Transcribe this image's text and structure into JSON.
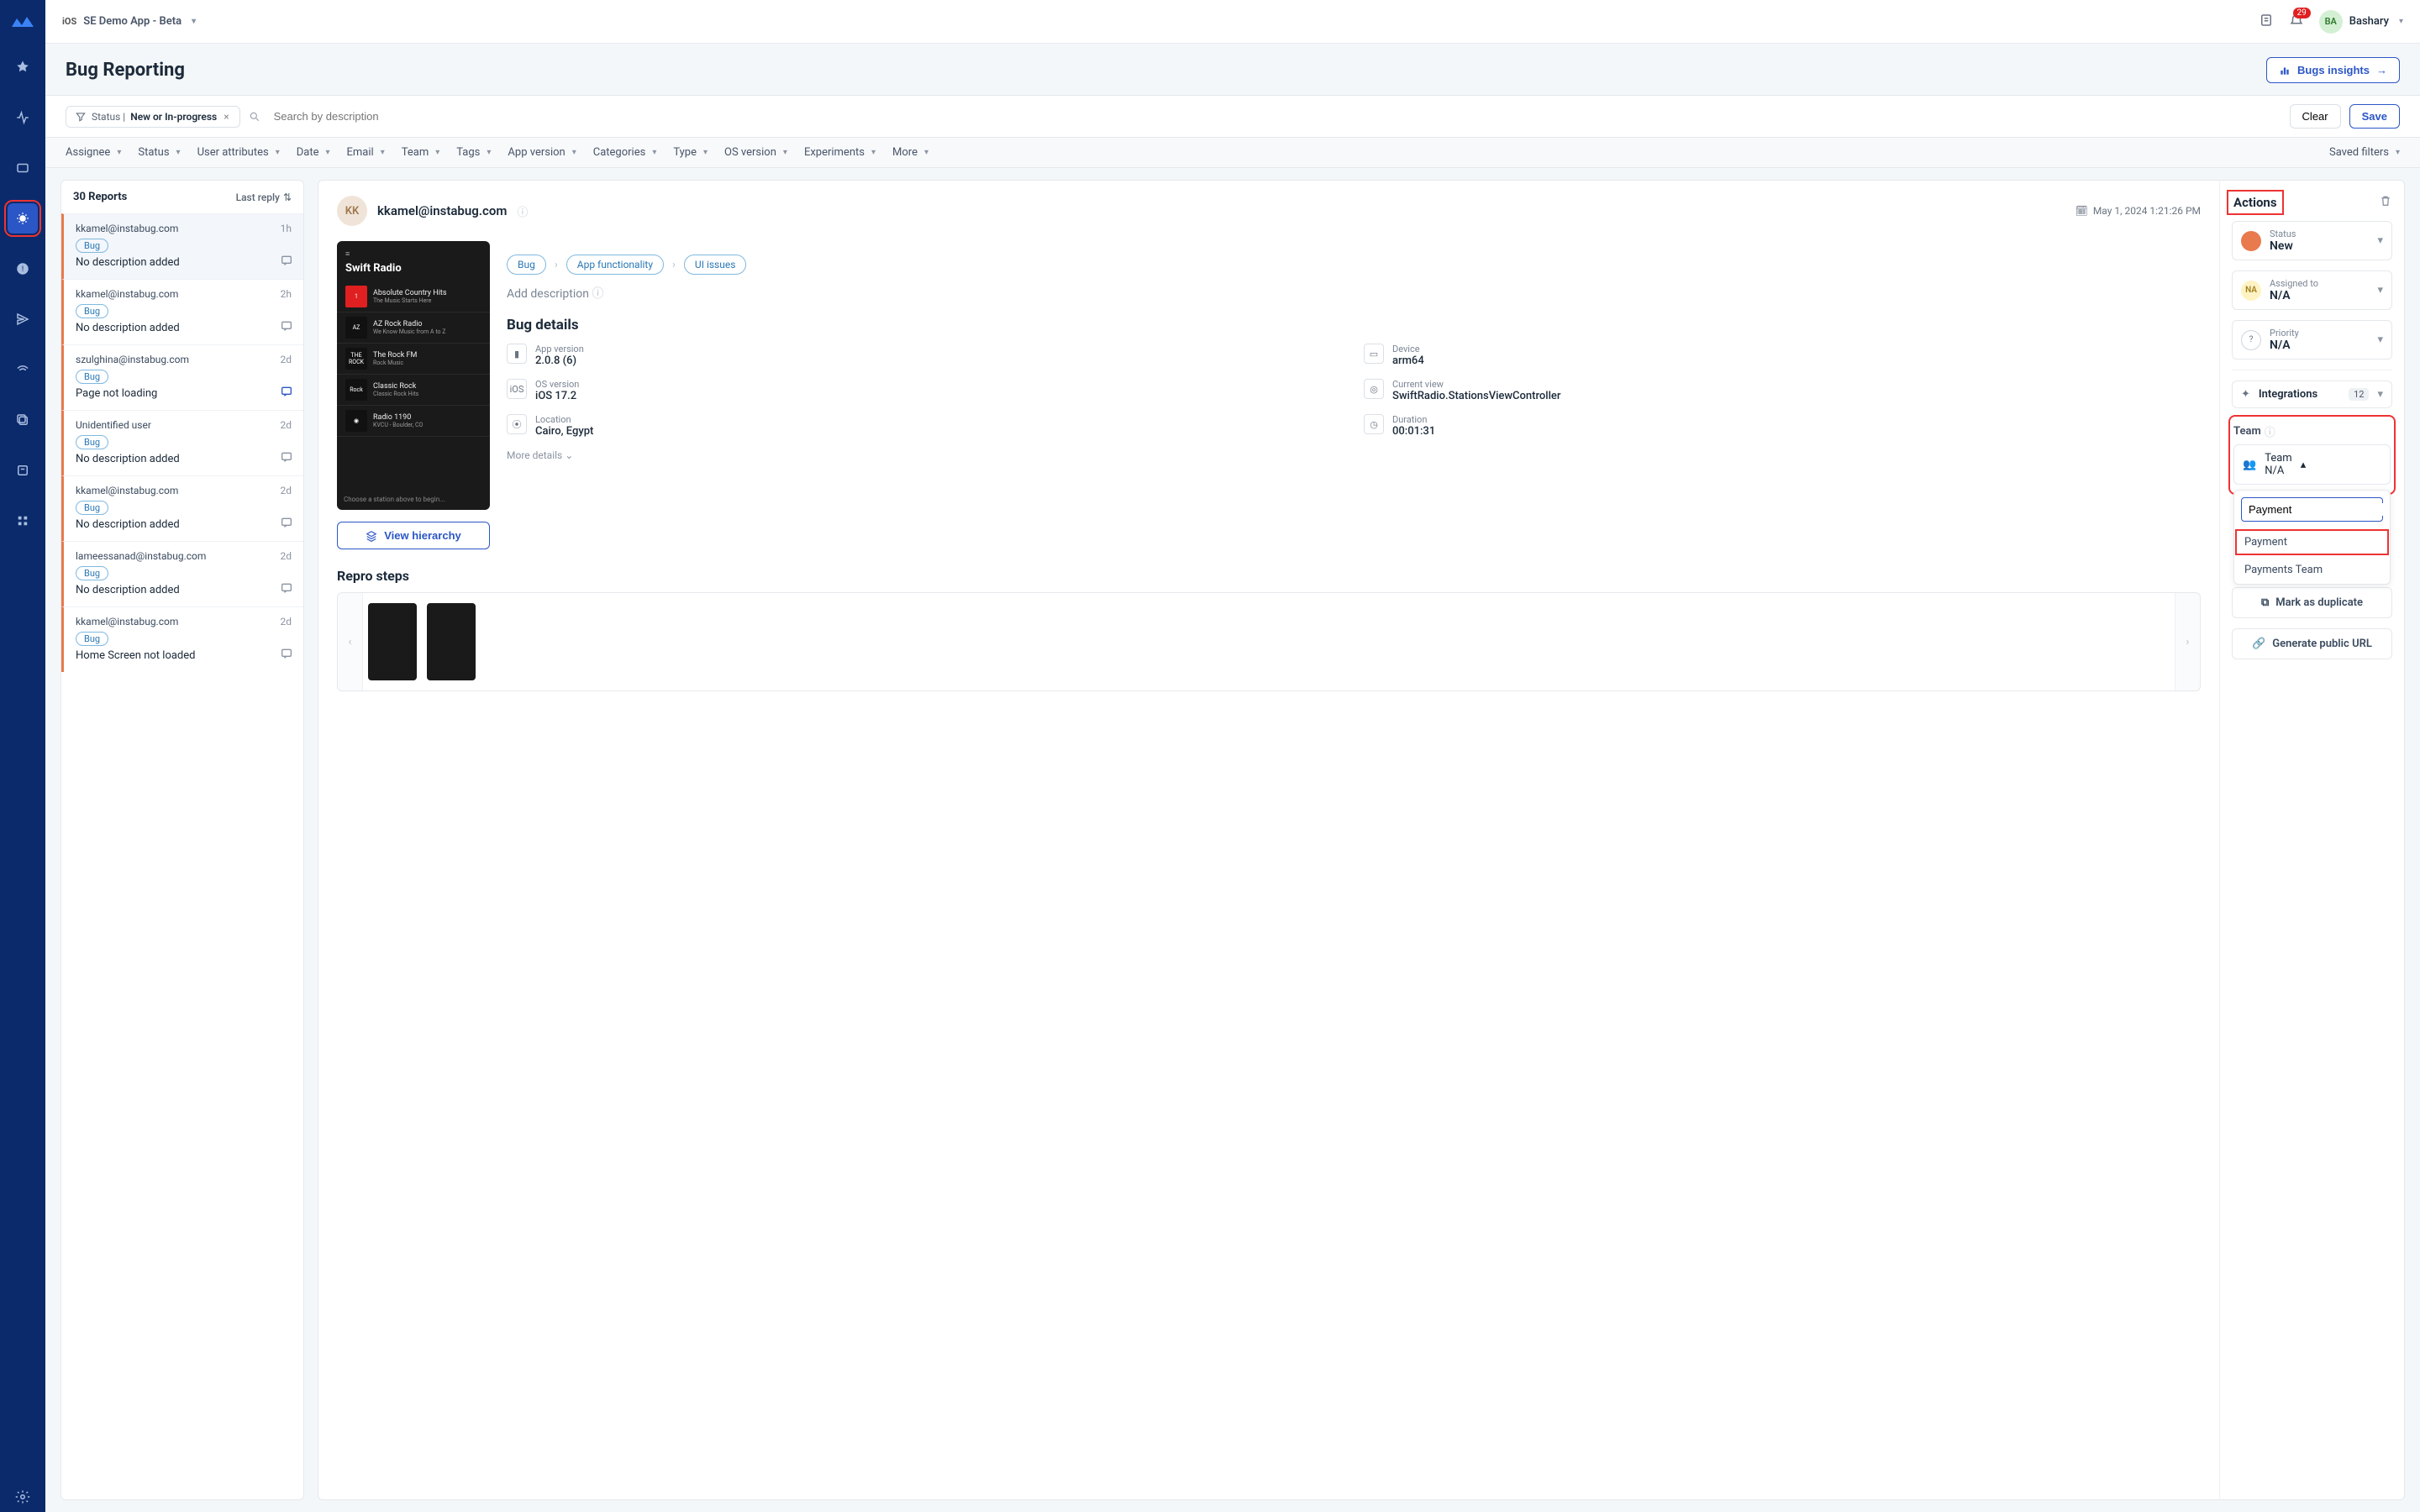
{
  "header": {
    "platform_badge": "iOS",
    "app_name": "SE Demo App - Beta",
    "notif_count": "29",
    "user_initials": "BA",
    "user_name": "Bashary"
  },
  "page": {
    "title": "Bug Reporting",
    "insights_button": "Bugs insights"
  },
  "filter_chip": {
    "prefix": "Status | ",
    "value": "New or In-progress"
  },
  "search_placeholder": "Search by description",
  "buttons": {
    "clear": "Clear",
    "save": "Save"
  },
  "filters": [
    "Assignee",
    "Status",
    "User attributes",
    "Date",
    "Email",
    "Team",
    "Tags",
    "App version",
    "Categories",
    "Type",
    "OS version",
    "Experiments",
    "More"
  ],
  "saved_filters_label": "Saved filters",
  "reports": {
    "count_label": "30 Reports",
    "sort_label": "Last reply",
    "items": [
      {
        "email": "kkamel@instabug.com",
        "time": "1h",
        "tag": "Bug",
        "desc": "No description added",
        "active_reply": false
      },
      {
        "email": "kkamel@instabug.com",
        "time": "2h",
        "tag": "Bug",
        "desc": "No description added",
        "active_reply": false
      },
      {
        "email": "szulghina@instabug.com",
        "time": "2d",
        "tag": "Bug",
        "desc": "Page not loading",
        "active_reply": true
      },
      {
        "email": "Unidentified user",
        "time": "2d",
        "tag": "Bug",
        "desc": "No description added",
        "active_reply": false
      },
      {
        "email": "kkamel@instabug.com",
        "time": "2d",
        "tag": "Bug",
        "desc": "No description added",
        "active_reply": false
      },
      {
        "email": "lameessanad@instabug.com",
        "time": "2d",
        "tag": "Bug",
        "desc": "No description added",
        "active_reply": false
      },
      {
        "email": "kkamel@instabug.com",
        "time": "2d",
        "tag": "Bug",
        "desc": "Home Screen not loaded",
        "active_reply": false
      }
    ]
  },
  "detail": {
    "avatar_initials": "KK",
    "email": "kkamel@instabug.com",
    "timestamp": "May 1, 2024 1:21:26 PM",
    "crumbs": [
      "Bug",
      "App functionality",
      "UI issues"
    ],
    "add_description": "Add description",
    "phone_title": "Swift Radio",
    "stations": [
      {
        "name": "Absolute Country Hits",
        "sub": "The Music Starts Here",
        "thumb": "1",
        "bg": "#e02020"
      },
      {
        "name": "AZ Rock Radio",
        "sub": "We Know Music from A to Z",
        "thumb": "AZ",
        "bg": "#111"
      },
      {
        "name": "The Rock FM",
        "sub": "Rock Music",
        "thumb": "THE ROCK",
        "bg": "#111"
      },
      {
        "name": "Classic Rock",
        "sub": "Classic Rock Hits",
        "thumb": "Rock",
        "bg": "#111"
      },
      {
        "name": "Radio 1190",
        "sub": "KVCU - Boulder, CO",
        "thumb": "◉",
        "bg": "#111"
      }
    ],
    "phone_footer": "Choose a station above to begin...",
    "bug_details_title": "Bug details",
    "details": {
      "app_version": {
        "label": "App version",
        "value": "2.0.8 (6)"
      },
      "device": {
        "label": "Device",
        "value": "arm64"
      },
      "os_version": {
        "label": "OS version",
        "value": "iOS 17.2"
      },
      "current_view": {
        "label": "Current view",
        "value": "SwiftRadio.StationsViewController"
      },
      "location": {
        "label": "Location",
        "value": "Cairo, Egypt"
      },
      "duration": {
        "label": "Duration",
        "value": "00:01:31"
      }
    },
    "more_details": "More details",
    "view_hierarchy": "View hierarchy",
    "repro_title": "Repro steps"
  },
  "actions": {
    "title": "Actions",
    "status": {
      "label": "Status",
      "value": "New"
    },
    "assigned": {
      "label": "Assigned to",
      "value": "N/A",
      "initials": "NA"
    },
    "priority": {
      "label": "Priority",
      "value": "N/A"
    },
    "integrations": {
      "label": "Integrations",
      "count": "12"
    },
    "team_section_label": "Team",
    "team": {
      "label": "Team",
      "value": "N/A"
    },
    "team_search_value": "Payment",
    "team_options": [
      "Payment",
      "Payments Team"
    ],
    "mark_duplicate": "Mark as duplicate",
    "generate_url": "Generate public URL"
  }
}
